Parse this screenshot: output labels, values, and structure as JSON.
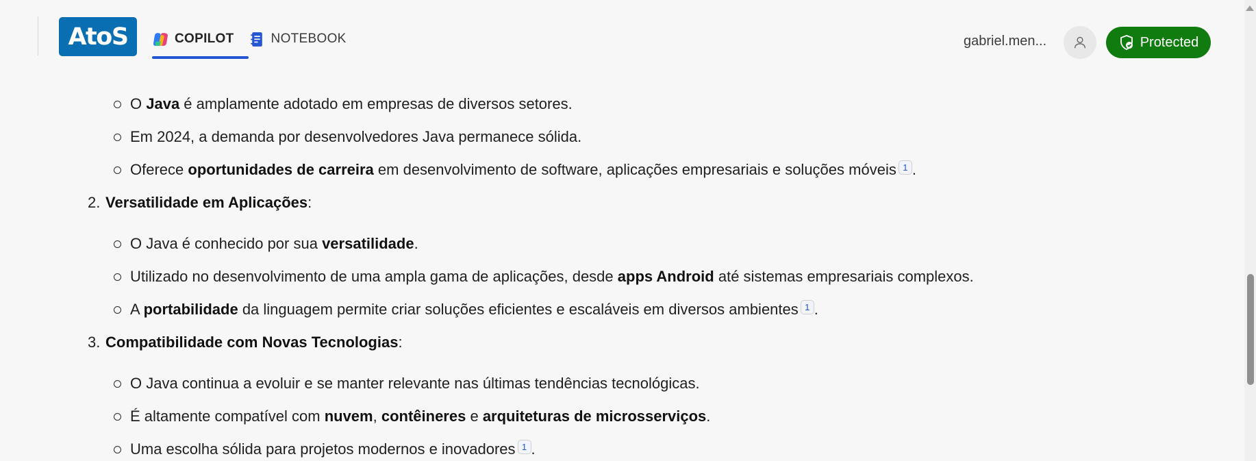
{
  "header": {
    "logo_text": "AtoS",
    "tabs": [
      {
        "label": "COPILOT",
        "icon": "copilot-icon",
        "active": true
      },
      {
        "label": "NOTEBOOK",
        "icon": "notebook-icon",
        "active": false
      }
    ],
    "user_name": "gabriel.men...",
    "protected_label": "Protected",
    "colors": {
      "logo": "#0a6eb2",
      "accent": "#2456d1",
      "protected": "#107c10"
    }
  },
  "content": {
    "items": [
      {
        "kind": "bullet",
        "parts": [
          {
            "t": "O "
          },
          {
            "t": "Java",
            "b": true
          },
          {
            "t": " é amplamente adotado em empresas de diversos setores."
          }
        ]
      },
      {
        "kind": "bullet",
        "parts": [
          {
            "t": "Em 2024, a demanda por desenvolvedores Java permanece sólida."
          }
        ]
      },
      {
        "kind": "bullet",
        "parts": [
          {
            "t": "Oferece "
          },
          {
            "t": "oportunidades de carreira",
            "b": true
          },
          {
            "t": " em desenvolvimento de software, aplicações empresariais e soluções móveis"
          },
          {
            "cite": "1"
          },
          {
            "t": "."
          }
        ]
      },
      {
        "kind": "number",
        "num": "2.",
        "parts": [
          {
            "t": "Versatilidade em Aplicações",
            "b": true
          },
          {
            "t": ":"
          }
        ]
      },
      {
        "kind": "bullet",
        "parts": [
          {
            "t": "O Java é conhecido por sua "
          },
          {
            "t": "versatilidade",
            "b": true
          },
          {
            "t": "."
          }
        ]
      },
      {
        "kind": "bullet",
        "parts": [
          {
            "t": "Utilizado no desenvolvimento de uma ampla gama de aplicações, desde "
          },
          {
            "t": "apps Android",
            "b": true
          },
          {
            "t": " até sistemas empresariais complexos."
          }
        ]
      },
      {
        "kind": "bullet",
        "parts": [
          {
            "t": "A "
          },
          {
            "t": "portabilidade",
            "b": true
          },
          {
            "t": " da linguagem permite criar soluções eficientes e escaláveis em diversos ambientes"
          },
          {
            "cite": "1"
          },
          {
            "t": "."
          }
        ]
      },
      {
        "kind": "number",
        "num": "3.",
        "parts": [
          {
            "t": "Compatibilidade com Novas Tecnologias",
            "b": true
          },
          {
            "t": ":"
          }
        ]
      },
      {
        "kind": "bullet",
        "parts": [
          {
            "t": "O Java continua a evoluir e se manter relevante nas últimas tendências tecnológicas."
          }
        ]
      },
      {
        "kind": "bullet",
        "parts": [
          {
            "t": "É altamente compatível com "
          },
          {
            "t": "nuvem",
            "b": true
          },
          {
            "t": ", "
          },
          {
            "t": "contêineres",
            "b": true
          },
          {
            "t": " e "
          },
          {
            "t": "arquiteturas de microsserviços",
            "b": true
          },
          {
            "t": "."
          }
        ]
      },
      {
        "kind": "bullet",
        "parts": [
          {
            "t": "Uma escolha sólida para projetos modernos e inovadores"
          },
          {
            "cite": "1"
          },
          {
            "t": "."
          }
        ]
      }
    ]
  }
}
